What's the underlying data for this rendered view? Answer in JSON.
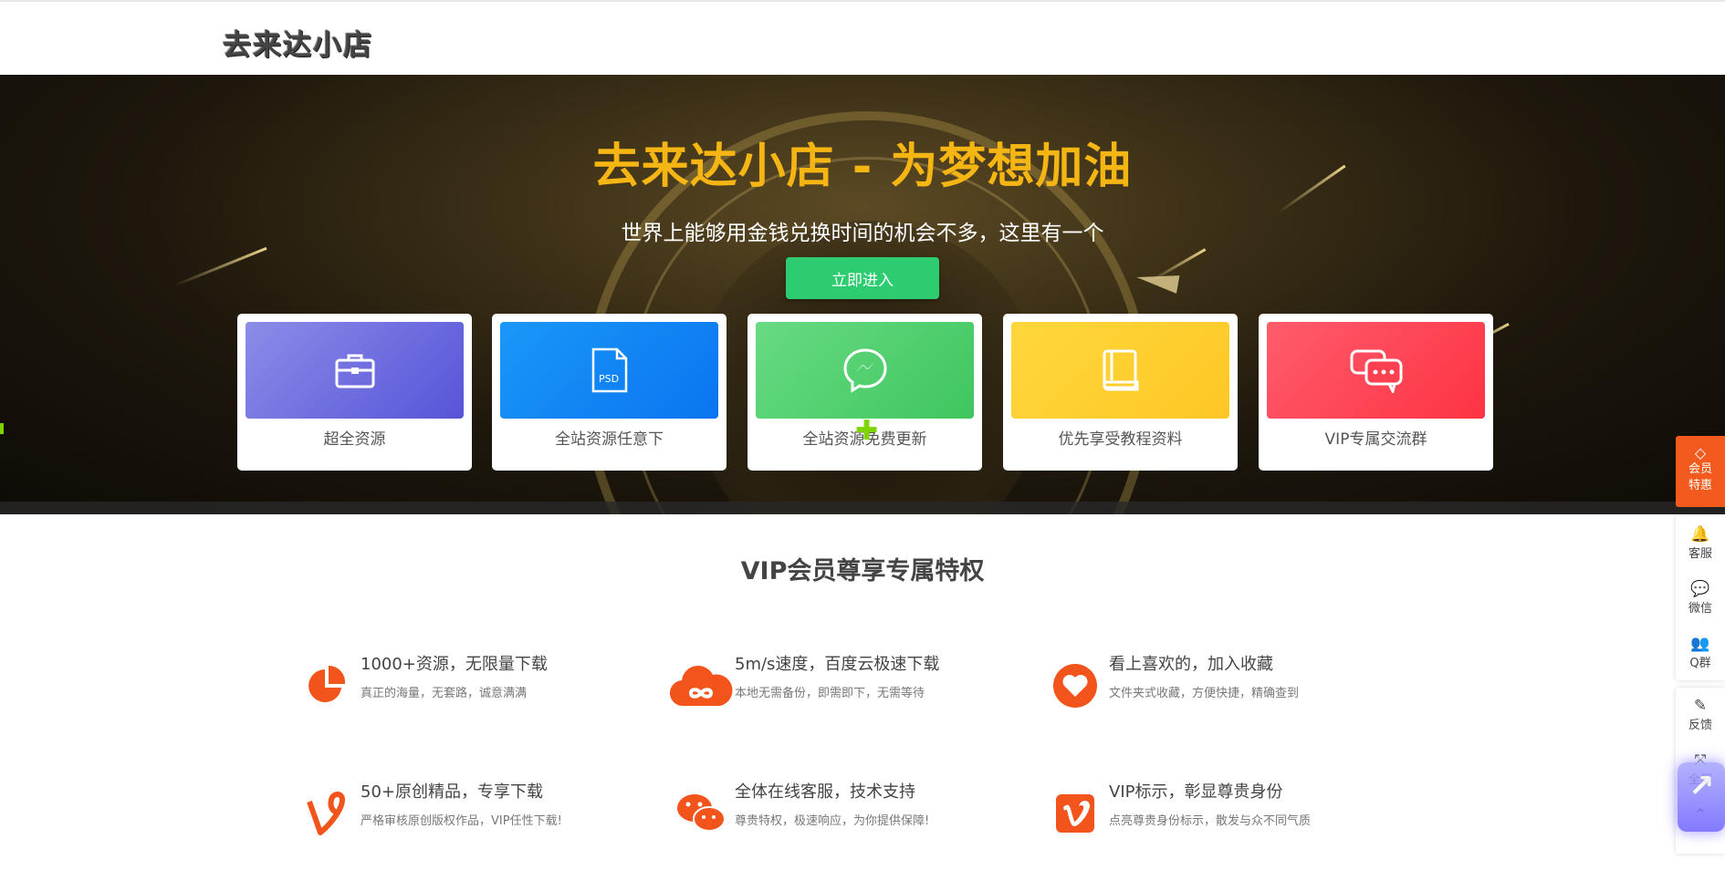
{
  "header": {
    "logo_text": "去来达小店"
  },
  "hero": {
    "title": "去来达小店 - 为梦想加油",
    "subtitle": "世界上能够用金钱兑换时间的机会不多，这里有一个",
    "enter_button": "立即进入",
    "cards": [
      {
        "label": "超全资源",
        "icon": "briefcase-icon"
      },
      {
        "label": "全站资源任意下",
        "icon": "psd-file-icon"
      },
      {
        "label": "全站资源免费更新",
        "icon": "messenger-icon"
      },
      {
        "label": "优先享受教程资料",
        "icon": "book-icon"
      },
      {
        "label": "VIP专属交流群",
        "icon": "chat-icon"
      }
    ]
  },
  "vip": {
    "title": "VIP会员尊享专属特权",
    "features": [
      {
        "title": "1000+资源，无限量下载",
        "desc": "真正的海量，无套路，诚意满满",
        "icon": "pie-chart-icon"
      },
      {
        "title": "5m/s速度，百度云极速下载",
        "desc": "本地无需备份，即需即下，无需等待",
        "icon": "cloud-icon"
      },
      {
        "title": "看上喜欢的，加入收藏",
        "desc": "文件夹式收藏，方便快捷，精确查到",
        "icon": "heart-icon"
      },
      {
        "title": "50+原创精品，专享下载",
        "desc": "严格审核原创版权作品，VIP任性下载!",
        "icon": "vine-icon"
      },
      {
        "title": "全体在线客服，技术支持",
        "desc": "尊贵特权，极速响应，为你提供保障!",
        "icon": "wechat-icon"
      },
      {
        "title": "VIP标示，彰显尊贵身份",
        "desc": "点亮尊贵身份标示，散发与众不同气质",
        "icon": "vimeo-icon"
      }
    ]
  },
  "sidebar": {
    "vip_line1": "会员",
    "vip_line2": "特惠",
    "items": [
      {
        "label": "客服",
        "icon": "qq-icon"
      },
      {
        "label": "微信",
        "icon": "wechat-icon"
      },
      {
        "label": "Q群",
        "icon": "group-icon"
      },
      {
        "label": "反馈",
        "icon": "edit-icon"
      },
      {
        "label": "全屏",
        "icon": "fullscreen-icon"
      }
    ]
  },
  "colors": {
    "title_gold": "#f5b613",
    "enter_green": "#2ecc71",
    "feature_orange": "#f2541b",
    "vip_tab_orange": "#f25a1e"
  }
}
